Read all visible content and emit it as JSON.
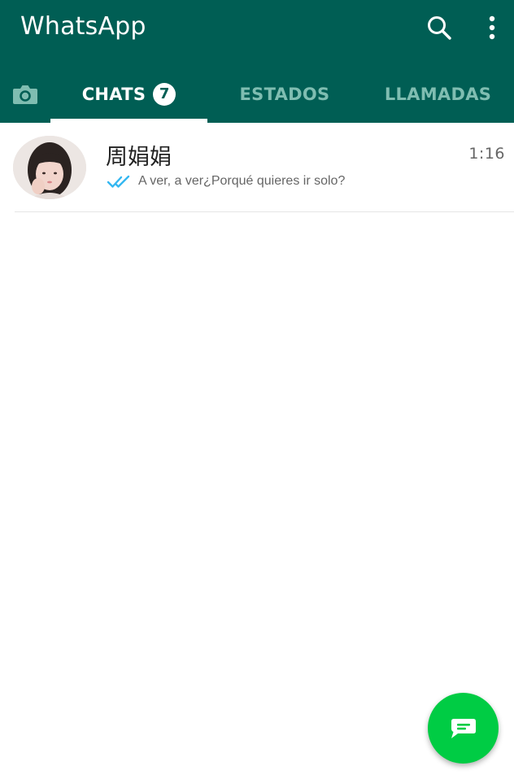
{
  "app": {
    "title": "WhatsApp",
    "brand_color": "#005e54",
    "fab_color": "#00cc44"
  },
  "toolbar": {
    "search_icon": "search-icon",
    "menu_icon": "more-vert-icon"
  },
  "tabs": {
    "camera_icon": "camera-icon",
    "items": [
      {
        "label": "CHATS",
        "badge": "7",
        "selected": true
      },
      {
        "label": "ESTADOS",
        "selected": false
      },
      {
        "label": "LLAMADAS",
        "selected": false
      }
    ]
  },
  "chats": [
    {
      "name": "周娟娟",
      "time": "1:16",
      "status_icon": "double-check-icon",
      "status_color": "#34b7f1",
      "preview": "A ver, a ver¿Porqué quieres ir solo?"
    }
  ],
  "fab": {
    "icon": "new-chat-icon"
  }
}
